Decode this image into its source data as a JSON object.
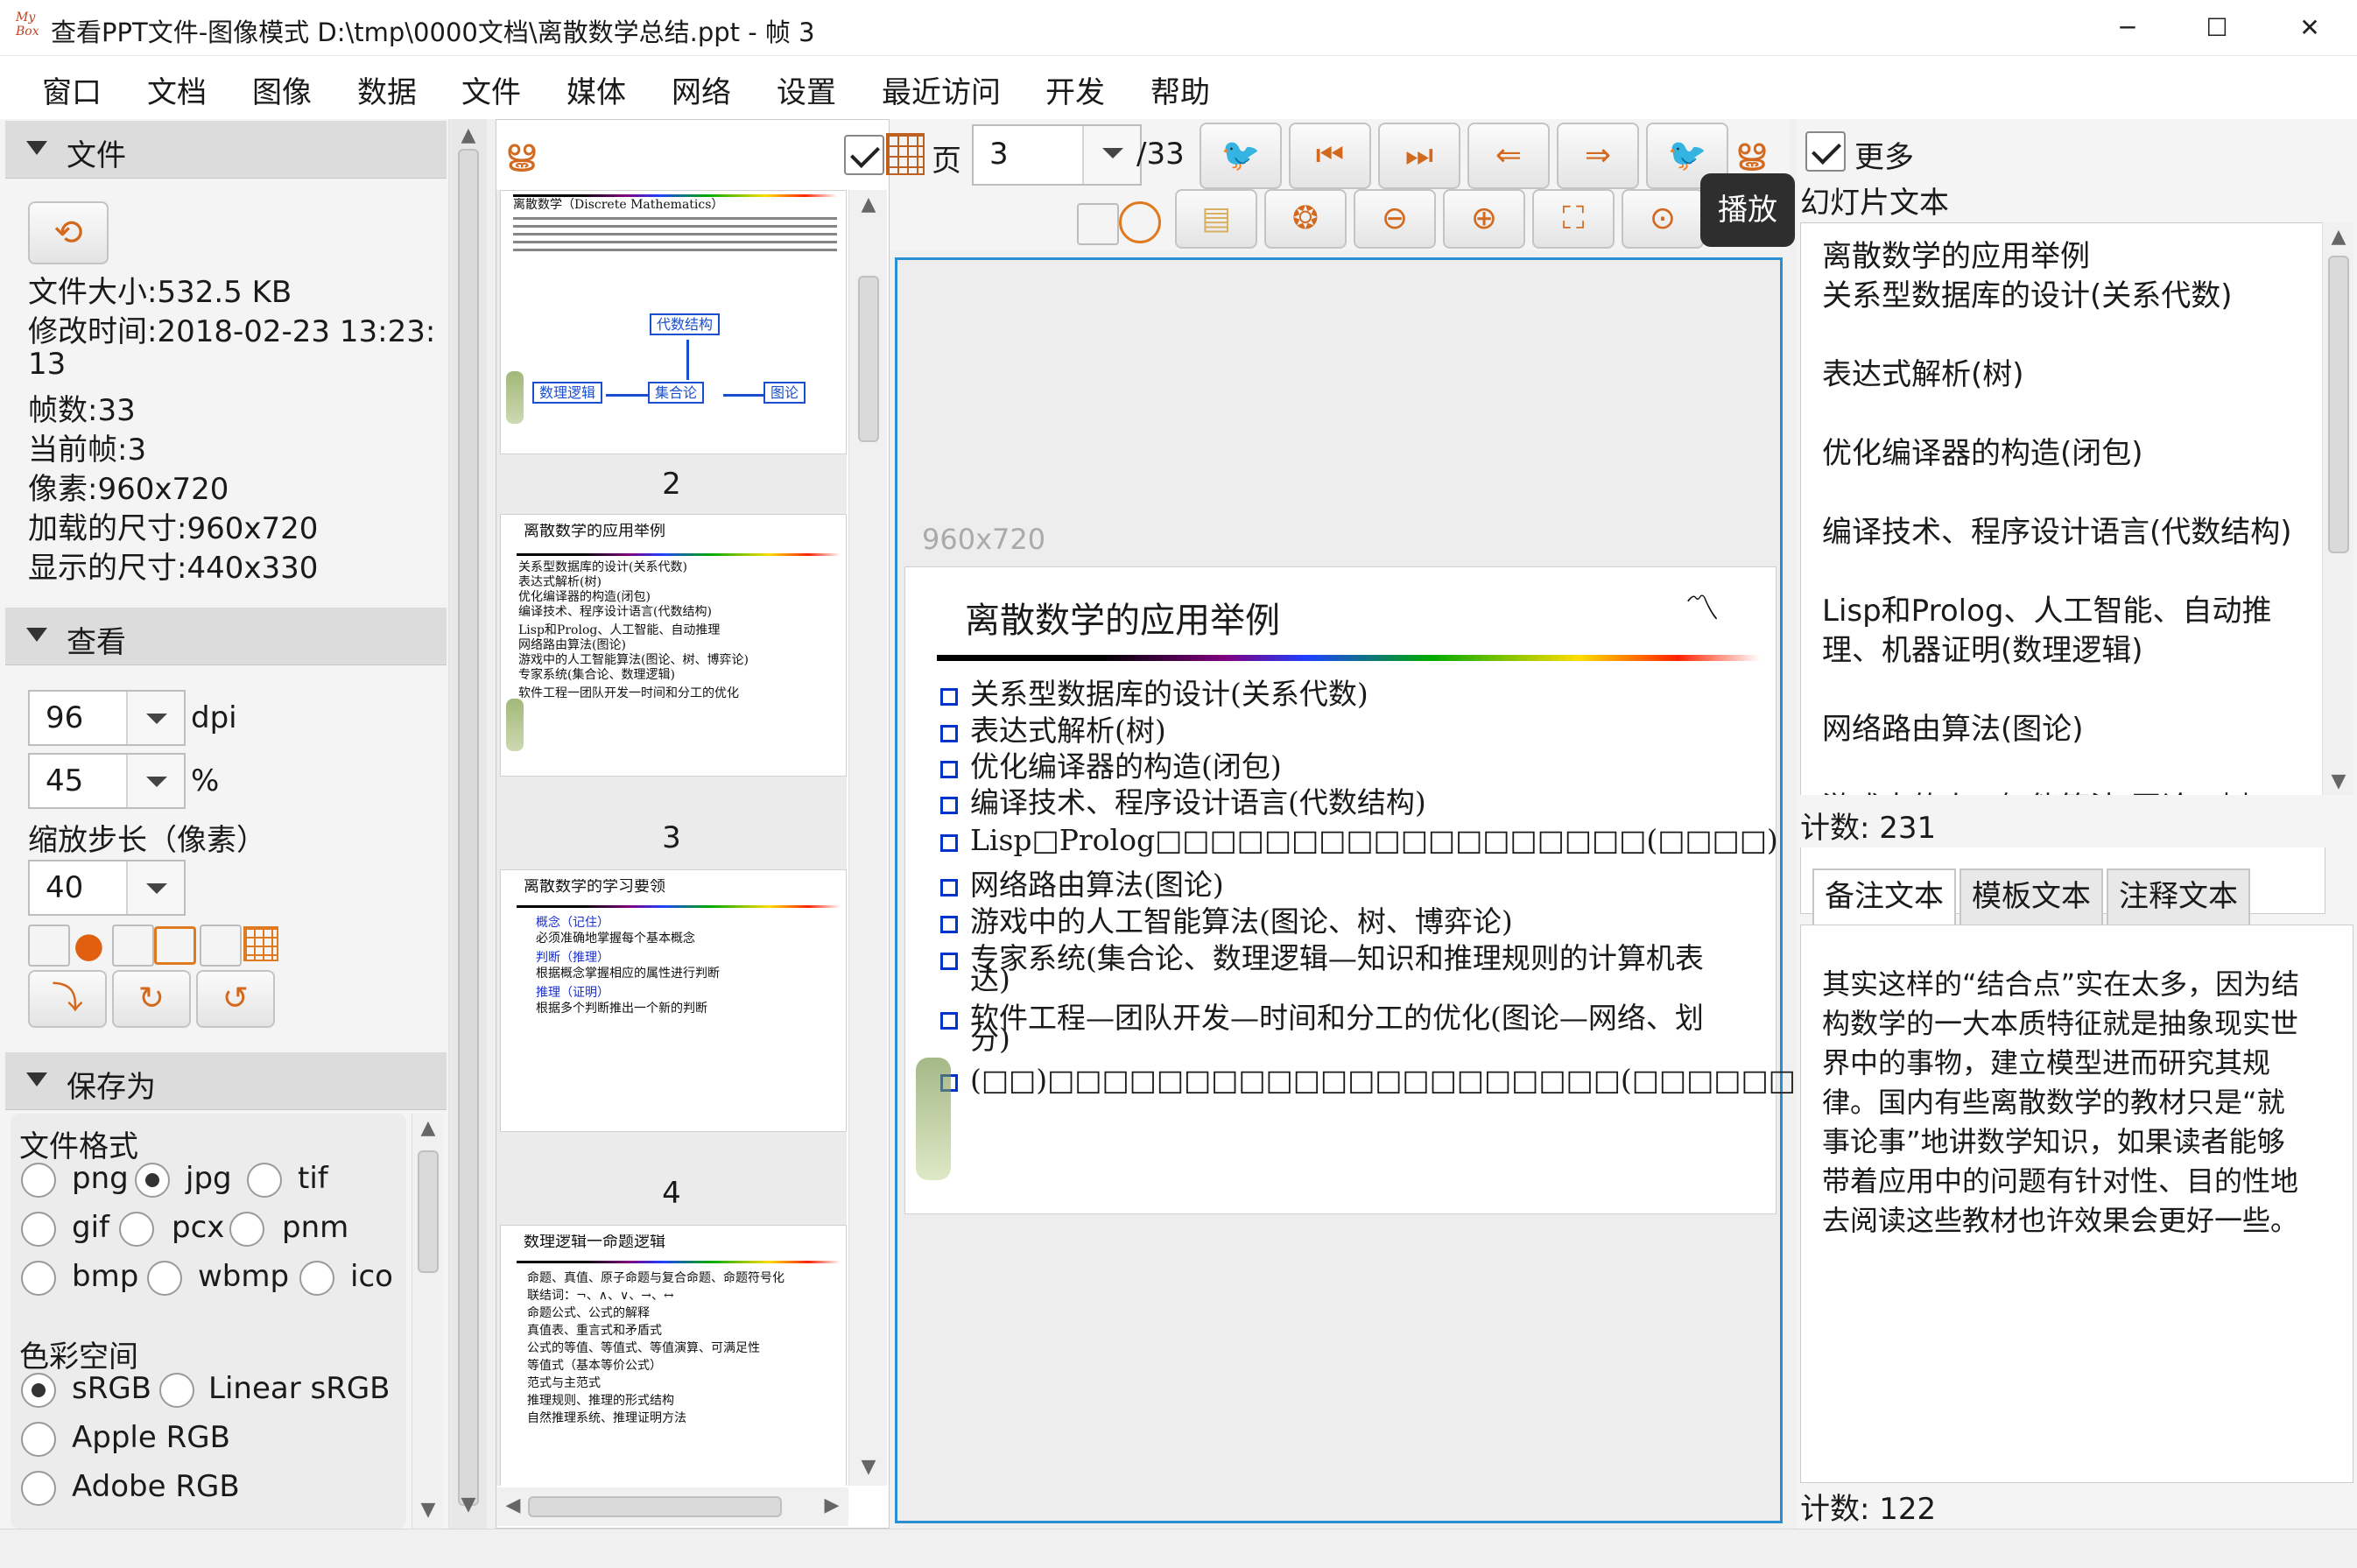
{
  "window": {
    "title": "查看PPT文件-图像模式 D:\\tmp\\0000文档\\离散数学总结.ppt - 帧 3",
    "logo_text": "My Box",
    "minimize": "─",
    "maximize": "☐",
    "close": "✕"
  },
  "menu": [
    "窗口",
    "文档",
    "图像",
    "数据",
    "文件",
    "媒体",
    "网络",
    "设置",
    "最近访问",
    "开发",
    "帮助"
  ],
  "left": {
    "file_section": "文件",
    "file_info": {
      "size": "文件大小:532.5 KB",
      "modified": "修改时间:2018-02-23 13:23:",
      "modified_cont": "13",
      "frames": "帧数:33",
      "current": "当前帧:3",
      "pixels": "像素:960x720",
      "loaded": "加载的尺寸:960x720",
      "displayed": "显示的尺寸:440x330"
    },
    "view_section": "查看",
    "dpi_value": "96",
    "dpi_unit": "dpi",
    "zoom_value": "45",
    "zoom_unit": "%",
    "step_label": "缩放步长（像素）",
    "step_value": "40",
    "save_section": "保存为",
    "format_label": "文件格式",
    "formats": [
      "png",
      "jpg",
      "tif",
      "gif",
      "pcx",
      "pnm",
      "bmp",
      "wbmp",
      "ico"
    ],
    "format_selected": "jpg",
    "color_label": "色彩空间",
    "colorspaces": [
      "sRGB",
      "Linear sRGB",
      "Apple RGB",
      "Adobe RGB"
    ],
    "colorspace_selected": "sRGB"
  },
  "thumbs": {
    "pages": [
      "2",
      "3",
      "4"
    ],
    "slide1": {
      "lines": [
        "离散数学（Discrete Mathematics）"
      ],
      "boxes": [
        "代数结构",
        "数理逻辑",
        "集合论",
        "图论"
      ]
    },
    "slide2": {
      "title": "离散数学的应用举例",
      "lines": [
        "关系型数据库的设计(关系代数)",
        "表达式解析(树)",
        "优化编译器的构造(闭包)",
        "编译技术、程序设计语言(代数结构)",
        "Lisp和Prolog、人工智能、自动推理",
        "网络路由算法(图论)",
        "游戏中的人工智能算法(图论、树、博弈论)",
        "专家系统(集合论、数理逻辑)",
        "软件工程一团队开发一时间和分工的优化"
      ]
    },
    "slide3": {
      "title": "离散数学的学习要领",
      "lines": [
        "概念（记住）",
        "  必须准确地掌握每个基本概念",
        "判断（推理）",
        "  根据概念掌握相应的属性进行判断",
        "推理（证明）",
        "  根据多个判断推出一个新的判断"
      ]
    },
    "slide4": {
      "title": "数理逻辑一命题逻辑",
      "lines": [
        "命题、真值、原子命题与复合命题、命题符号化",
        "联结词：¬、∧、∨、→、↔",
        "命题公式、公式的解释",
        "真值表、重言式和矛盾式",
        "公式的等值、等值式、等值演算、可满足性",
        "等值式（基本等价公式）",
        "范式与主范式",
        "推理规则、推理的形式结构",
        "自然推理系统、推理证明方法"
      ]
    }
  },
  "toolbar": {
    "page_label": "页",
    "page_value": "3",
    "page_total": "/33",
    "tooltip": "播放"
  },
  "main": {
    "size_label": "960x720",
    "slide_title": "离散数学的应用举例",
    "bullets": [
      "关系型数据库的设计(关系代数)",
      "表达式解析(树)",
      "优化编译器的构造(闭包)",
      "编译技术、程序设计语言(代数结构)",
      "Lisp□Prolog□□□□□□□□□□□□□□□□□□(□□□□)",
      "网络路由算法(图论)",
      "游戏中的人工智能算法(图论、树、博弈论)",
      "专家系统(集合论、数理逻辑—知识和推理规则的计算机表",
      "达)",
      "软件工程—团队开发—时间和分工的优化(图论—网络、划",
      "分)",
      "(□□)□□□□□□□□□□□□□□□□□□□□□(□□□□□□□□)"
    ]
  },
  "right": {
    "more_label": "更多",
    "slide_text_label": "幻灯片文本",
    "slide_text": [
      "离散数学的应用举例",
      "关系型数据库的设计(关系代数)",
      "",
      "表达式解析(树)",
      "",
      "优化编译器的构造(闭包)",
      "",
      "编译技术、程序设计语言(代数结构)",
      "",
      "Lisp和Prolog、人工智能、自动推",
      "理、机器证明(数理逻辑)",
      "",
      "网络路由算法(图论)",
      "",
      "游戏中的人工智能算法(图论、树"
    ],
    "count1": "计数: 231",
    "tabs": [
      "备注文本",
      "模板文本",
      "注释文本"
    ],
    "notes": [
      "其实这样的“结合点”实在太多，因为结",
      "构数学的一大本质特征就是抽象现实世",
      "界中的事物，建立模型进而研究其规",
      "律。国内有些离散数学的教材只是“就",
      "事论事”地讲数学知识，如果读者能够",
      "带着应用中的问题有针对性、目的性地",
      "去阅读这些教材也许效果会更好一些。"
    ],
    "count2": "计数: 122"
  },
  "colors": {
    "accent": "#2a8fd0",
    "icon": "#d2691e",
    "bullet": "#0033cc"
  }
}
